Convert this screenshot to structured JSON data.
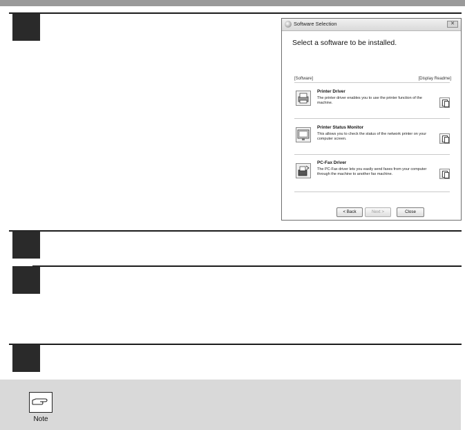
{
  "window": {
    "title": "Software Selection",
    "heading": "Select a software to be installed.",
    "col_software": "[Software]",
    "col_readme": "[Display Readme]",
    "items": [
      {
        "name": "Printer Driver",
        "description": "The printer driver enables you to use the printer function of the machine.",
        "icon": "printer-icon"
      },
      {
        "name": "Printer Status Monitor",
        "description": "This allows you to check the status of the network printer on your computer screen.",
        "icon": "monitor-icon"
      },
      {
        "name": "PC-Fax Driver",
        "description": "The PC-Fax driver lets you easily send faxes from your computer through the machine to another fax machine.",
        "icon": "fax-icon"
      }
    ],
    "buttons": {
      "back": "< Back",
      "next": "Next >",
      "close": "Close"
    }
  },
  "note": {
    "label": "Note",
    "icon": "pointing-hand-icon"
  },
  "colors": {
    "step_box": "#2a2a2a",
    "note_background": "#d9d9d9",
    "top_bar": "#9a9a9a"
  }
}
